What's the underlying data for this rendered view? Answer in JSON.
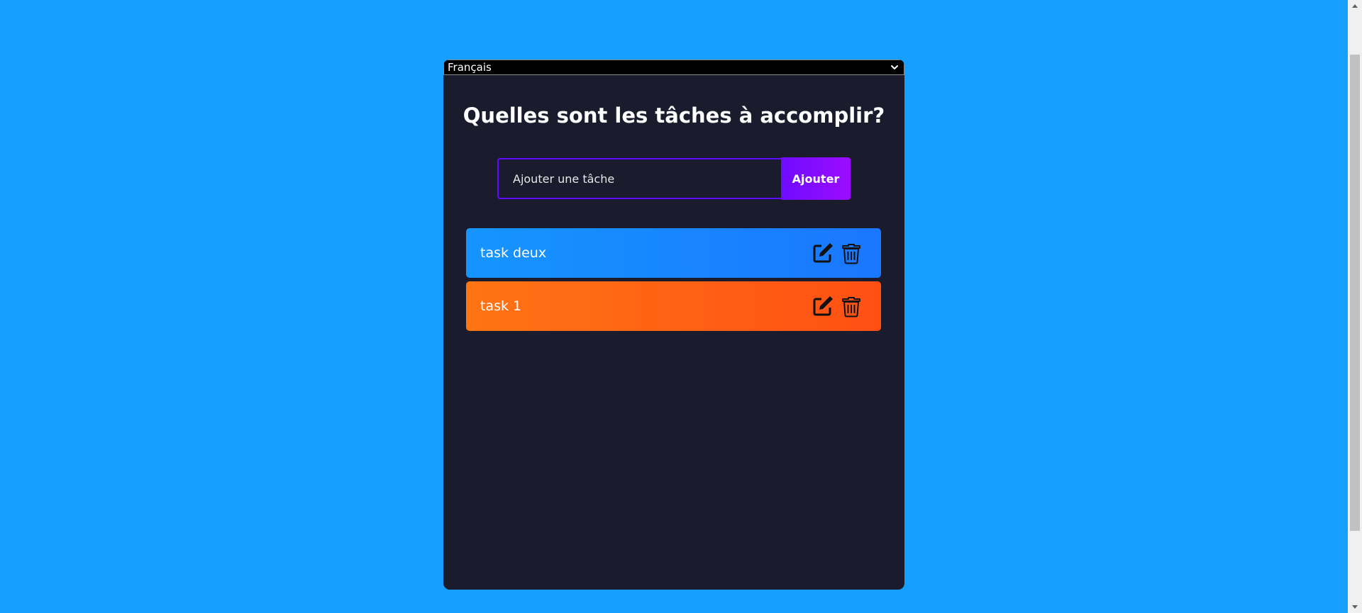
{
  "language_select": {
    "selected": "Français"
  },
  "title": "Quelles sont les tâches à accomplir?",
  "form": {
    "input_placeholder": "Ajouter une tâche",
    "input_value": "",
    "button_label": "Ajouter"
  },
  "todos": [
    {
      "text": "task deux",
      "color": "#1a86ff",
      "edit_icon": "edit-icon",
      "delete_icon": "trash-icon"
    },
    {
      "text": "task 1",
      "color": "#ff6214",
      "edit_icon": "edit-icon",
      "delete_icon": "trash-icon"
    }
  ],
  "colors": {
    "page_background": "#169ffe",
    "app_background": "#1a1b2c",
    "accent": "#5d0cff"
  }
}
